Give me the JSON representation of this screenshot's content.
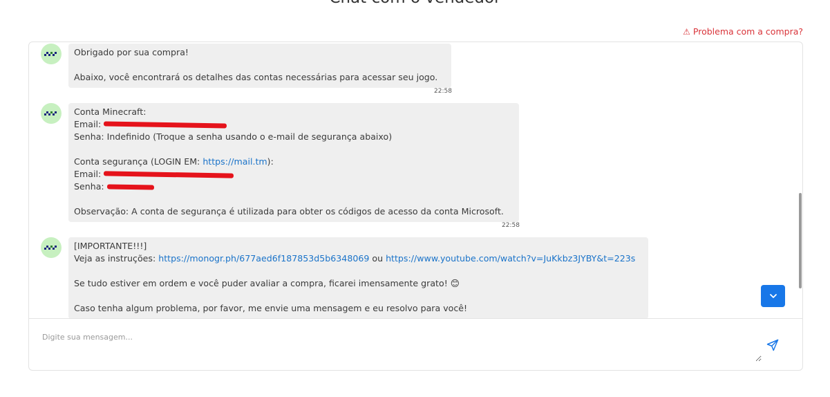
{
  "page": {
    "title": "Chat com o vendedor"
  },
  "problem_link": {
    "label": "Problema com a compra?"
  },
  "messages": [
    {
      "lines": [
        "Obrigado por sua compra!",
        "",
        "Abaixo, você encontrará os detalhes das contas necessárias para acessar seu jogo."
      ],
      "time": "22:58"
    },
    {
      "line1": "Conta Minecraft:",
      "email_label": "Email:",
      "senha_line": "Senha: Indefinido (Troque a senha usando o e-mail de segurança abaixo)",
      "seguranca_prefix": "Conta segurança (LOGIN EM: ",
      "seguranca_link": "https://mail.tm",
      "seguranca_suffix": "):",
      "email2_label": "Email:",
      "senha2_label": "Senha:",
      "observacao": "Observação: A conta de segurança é utilizada para obter os códigos de acesso da conta Microsoft.",
      "time": "22:58"
    },
    {
      "line1": "[IMPORTANTE!!!]",
      "instr_prefix": "Veja as instruções: ",
      "link1": "https://monogr.ph/677aed6f187853d5b6348069",
      "link_sep": " ou ",
      "link2": "https://www.youtube.com/watch?v=JuKkbz3JYBY&t=223s",
      "line3": "Se tudo estiver em ordem e você puder avaliar a compra, ficarei imensamente grato! 😊",
      "line4": "Caso tenha algum problema, por favor, me envie uma mensagem e eu resolvo para você!"
    }
  ],
  "input": {
    "placeholder": "Digite sua mensagem..."
  },
  "colors": {
    "accent": "#1877e8",
    "link": "#1a73c9",
    "warning": "#d9343a",
    "bubble": "#efefef",
    "avatar": "#c7f0c0",
    "redaction": "#e5131b"
  }
}
